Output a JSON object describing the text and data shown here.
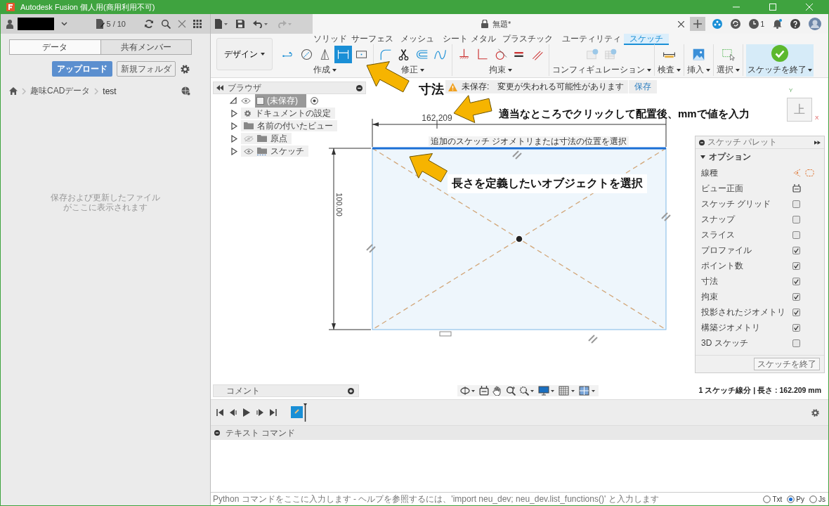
{
  "window": {
    "title": "Autodesk Fusion 個人用(商用利用不可)"
  },
  "data_panel": {
    "job_status": "5 / 10",
    "tabs": [
      {
        "label": "データ",
        "selected": true
      },
      {
        "label": "共有メンバー",
        "selected": false
      }
    ],
    "upload_button": "アップロード",
    "new_folder_button": "新規フォルダ",
    "breadcrumb": [
      "趣味CADデータ",
      "test"
    ],
    "empty_message": [
      "保存および更新したファイル",
      "がここに表示されます"
    ]
  },
  "document_tab": {
    "title": "無題*"
  },
  "job_notifications": "1",
  "workspace": "デザイン",
  "ribbon_tabs": [
    {
      "label": "ソリッド",
      "selected": false
    },
    {
      "label": "サーフェス",
      "selected": false
    },
    {
      "label": "メッシュ",
      "selected": false
    },
    {
      "label": "シート メタル",
      "selected": false
    },
    {
      "label": "プラスチック",
      "selected": false
    },
    {
      "label": "ユーティリティ",
      "selected": false
    },
    {
      "label": "スケッチ",
      "selected": true
    }
  ],
  "ribbon_groups": [
    {
      "kind": "tools",
      "label": "作成",
      "tools": [
        {
          "selected": false
        },
        {
          "selected": false
        },
        {
          "selected": false
        },
        {
          "selected": true
        },
        {
          "selected": false
        }
      ]
    },
    {
      "kind": "tools",
      "label": "修正",
      "tools": [
        {
          "selected": false
        },
        {
          "selected": false
        },
        {
          "selected": false
        },
        {
          "selected": false
        }
      ]
    },
    {
      "kind": "tools",
      "label": "拘束",
      "tools": [
        {
          "selected": false
        },
        {
          "selected": false
        },
        {
          "selected": false
        },
        {
          "selected": false
        },
        {
          "selected": false
        }
      ]
    },
    {
      "kind": "tools",
      "label": "コンフィギュレーション",
      "tools": [
        {
          "selected": false
        },
        {
          "selected": false
        }
      ]
    },
    {
      "kind": "tools",
      "label": "検査",
      "tools": [
        {
          "selected": false
        }
      ]
    },
    {
      "kind": "tools",
      "label": "挿入",
      "tools": [
        {
          "selected": false
        }
      ]
    },
    {
      "kind": "tools",
      "label": "選択",
      "tools": [
        {
          "selected": false
        }
      ]
    },
    {
      "kind": "finish",
      "label": "スケッチを終了"
    }
  ],
  "unsaved_banner": {
    "label": "未保存:",
    "message": "変更が失われる可能性があります",
    "action": "保存"
  },
  "browser": {
    "title": "ブラウザ",
    "root": {
      "label": "(未保存)",
      "visible": true,
      "expanded": true,
      "children": [
        {
          "kind": "settings",
          "label": "ドキュメントの設定",
          "expanded": false
        },
        {
          "kind": "folder",
          "label": "名前の付いたビュー",
          "expanded": false
        },
        {
          "kind": "folder",
          "label": "原点",
          "visible": false,
          "expanded": false
        },
        {
          "kind": "sketch",
          "label": "スケッチ",
          "visible": true,
          "expanded": false
        }
      ]
    }
  },
  "sketch": {
    "horizontal_dimension": "162.209",
    "vertical_dimension": "100.00",
    "tooltip": "追加のスケッチ ジオメトリまたは寸法の位置を選択"
  },
  "view_cube": {
    "face": "上",
    "axes": [
      "Y",
      "X"
    ]
  },
  "annotations": [
    {
      "text": "寸法"
    },
    {
      "text": "適当なところでクリックして配置後、mmで値を入力"
    },
    {
      "text": "長さを定義したいオブジェクトを選択"
    }
  ],
  "palette": {
    "title": "スケッチ パレット",
    "section": "オプション",
    "options": [
      {
        "kind": "linetype",
        "label": "線種"
      },
      {
        "kind": "view",
        "label": "ビュー正面"
      },
      {
        "kind": "checkbox",
        "label": "スケッチ グリッド",
        "checked": false
      },
      {
        "kind": "checkbox",
        "label": "スナップ",
        "checked": false
      },
      {
        "kind": "checkbox",
        "label": "スライス",
        "checked": false
      },
      {
        "kind": "checkbox",
        "label": "プロファイル",
        "checked": true
      },
      {
        "kind": "checkbox",
        "label": "ポイント数",
        "checked": true
      },
      {
        "kind": "checkbox",
        "label": "寸法",
        "checked": true
      },
      {
        "kind": "checkbox",
        "label": "拘束",
        "checked": true
      },
      {
        "kind": "checkbox",
        "label": "投影されたジオメトリ",
        "checked": true
      },
      {
        "kind": "checkbox",
        "label": "構築ジオメトリ",
        "checked": true
      },
      {
        "kind": "checkbox",
        "label": "3D スケッチ",
        "checked": false
      }
    ],
    "finish_button": "スケッチを終了"
  },
  "comments": {
    "title": "コメント"
  },
  "status": "1 スケッチ線分 | 長さ : 162.209 mm",
  "command": {
    "title": "テキスト コマンド",
    "placeholder": "Python コマンドをここに入力します - ヘルプを参照するには、'import neu_dev; neu_dev.list_functions()' と入力します",
    "modes": [
      {
        "label": "Txt",
        "selected": false
      },
      {
        "label": "Py",
        "selected": true
      },
      {
        "label": "Js",
        "selected": false
      }
    ]
  }
}
